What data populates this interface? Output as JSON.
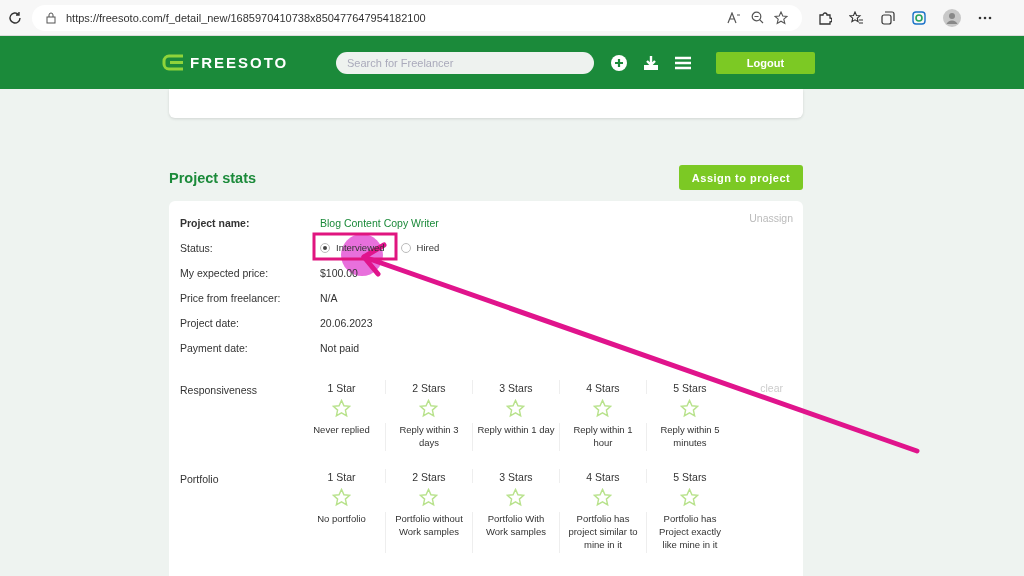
{
  "browser": {
    "url": "https://freesoto.com/f_detail_new/1685970410738x850477647954182100"
  },
  "header": {
    "logo": "FREESOTO",
    "search": {
      "placeholder": "Search for Freelancer"
    },
    "logout": "Logout"
  },
  "section": {
    "title": "Project stats",
    "assign_button": "Assign to project"
  },
  "project": {
    "unassign": "Unassign",
    "fields": [
      {
        "label": "Project name:",
        "value": "Blog Content Copy Writer",
        "kind": "link"
      },
      {
        "label": "Status:",
        "kind": "radio",
        "options": [
          {
            "label": "Interviewed",
            "selected": true
          },
          {
            "label": "Hired",
            "selected": false
          }
        ]
      },
      {
        "label": "My expected price:",
        "value": "$100.00",
        "kind": "text"
      },
      {
        "label": "Price from freelancer:",
        "value": "N/A",
        "kind": "text"
      },
      {
        "label": "Project date:",
        "value": "20.06.2023",
        "kind": "text"
      },
      {
        "label": "Payment date:",
        "value": "Not paid",
        "kind": "text"
      }
    ]
  },
  "ratings": [
    {
      "label": "Responsiveness",
      "clear": "clear",
      "stars": 0,
      "options": [
        {
          "title": "1 Star",
          "caption": "Never replied"
        },
        {
          "title": "2 Stars",
          "caption": "Reply within 3 days"
        },
        {
          "title": "3 Stars",
          "caption": "Reply within 1 day"
        },
        {
          "title": "4 Stars",
          "caption": "Reply within 1 hour"
        },
        {
          "title": "5 Stars",
          "caption": "Reply within 5 minutes"
        }
      ]
    },
    {
      "label": "Portfolio",
      "stars": 0,
      "options": [
        {
          "title": "1 Star",
          "caption": "No portfolio"
        },
        {
          "title": "2 Stars",
          "caption": "Portfolio without Work samples"
        },
        {
          "title": "3 Stars",
          "caption": "Portfolio With Work samples"
        },
        {
          "title": "4 Stars",
          "caption": "Portfolio has project similar to mine in it"
        },
        {
          "title": "5 Stars",
          "caption": "Portfolio has Project exactly like mine in it"
        }
      ]
    }
  ]
}
